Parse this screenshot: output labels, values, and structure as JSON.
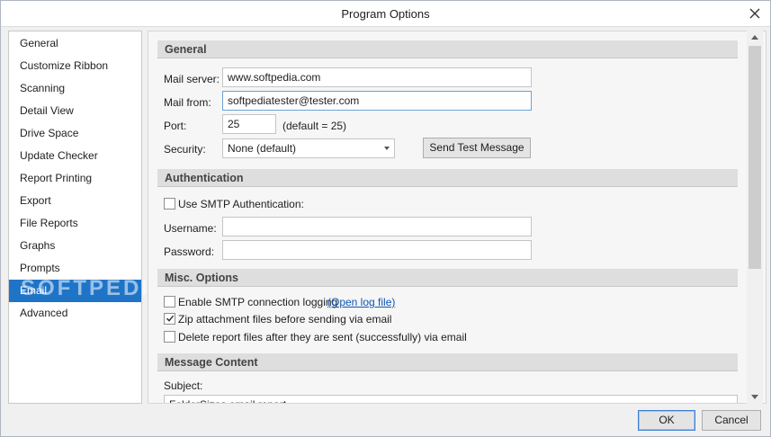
{
  "window": {
    "title": "Program Options"
  },
  "sidebar": {
    "items": [
      {
        "label": "General"
      },
      {
        "label": "Customize Ribbon"
      },
      {
        "label": "Scanning"
      },
      {
        "label": "Detail View"
      },
      {
        "label": "Drive Space"
      },
      {
        "label": "Update Checker"
      },
      {
        "label": "Report Printing"
      },
      {
        "label": "Export"
      },
      {
        "label": "File Reports"
      },
      {
        "label": "Graphs"
      },
      {
        "label": "Prompts"
      },
      {
        "label": "Email",
        "selected": true
      },
      {
        "label": "Advanced"
      }
    ]
  },
  "general": {
    "header": "General",
    "mail_server_label": "Mail server:",
    "mail_server_value": "www.softpedia.com",
    "mail_from_label": "Mail from:",
    "mail_from_value": "softpediatester@tester.com",
    "port_label": "Port:",
    "port_value": "25",
    "port_default": "(default = 25)",
    "security_label": "Security:",
    "security_value": "None (default)",
    "send_test_button": "Send Test Message"
  },
  "authentication": {
    "header": "Authentication",
    "use_smtp_label": "Use SMTP Authentication:",
    "use_smtp_checked": false,
    "username_label": "Username:",
    "username_value": "",
    "password_label": "Password:",
    "password_value": ""
  },
  "misc": {
    "header": "Misc. Options",
    "logging_label": "Enable SMTP connection logging",
    "logging_checked": false,
    "open_log_link": "(Open log file)",
    "zip_label": "Zip attachment files before sending via email",
    "zip_checked": true,
    "delete_label": "Delete report files after they are sent (successfully) via email",
    "delete_checked": false
  },
  "message_content": {
    "header": "Message Content",
    "subject_label": "Subject:",
    "subject_value": "FolderSizes email report"
  },
  "footer": {
    "ok_label": "OK",
    "cancel_label": "Cancel"
  },
  "watermark": "SOFTPEDIA",
  "colors": {
    "selection": "#1f74c8",
    "link": "#0b56b5",
    "section_header_bg": "#dedede"
  },
  "icons": {
    "close": "close-icon",
    "dropdown": "chevron-down-icon",
    "checkmark": "checkmark-icon",
    "scroll_up": "arrow-up-icon",
    "scroll_down": "arrow-down-icon"
  }
}
